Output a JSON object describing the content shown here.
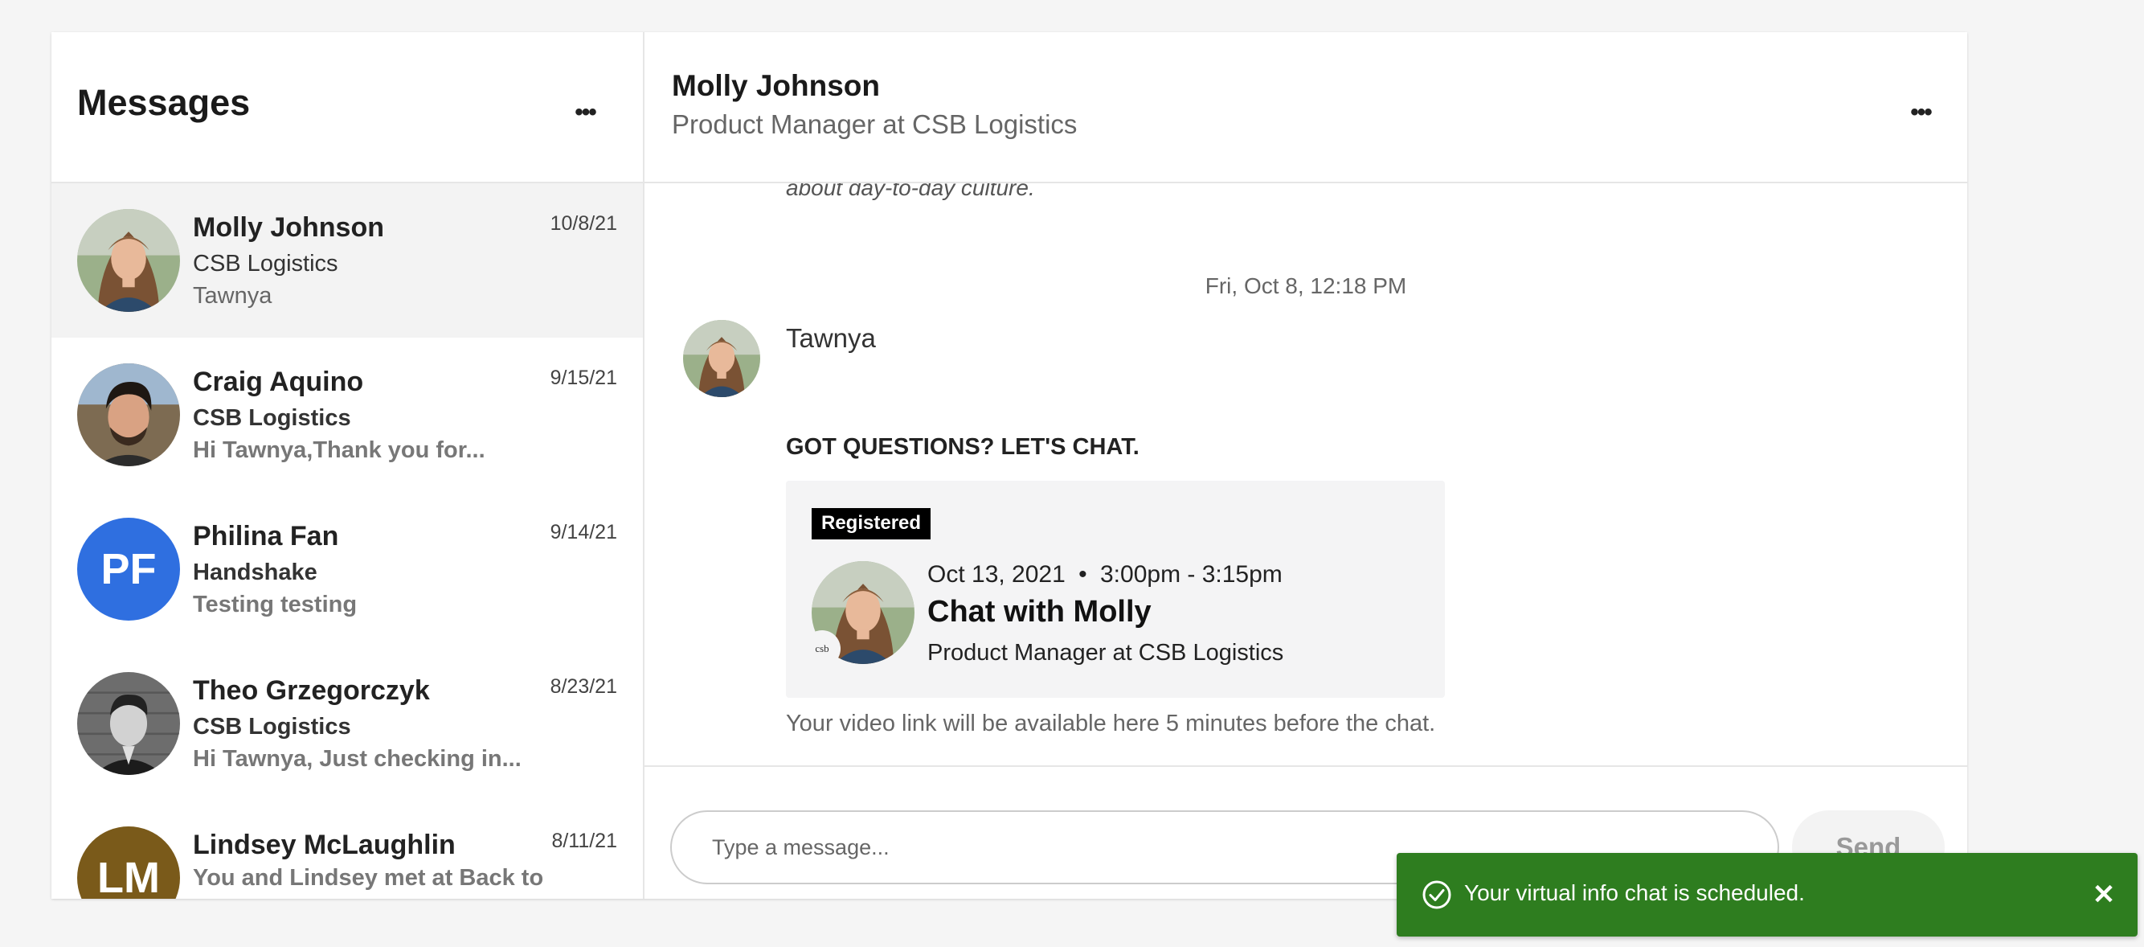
{
  "messages_panel": {
    "title": "Messages",
    "menu_icon": "ellipsis-icon",
    "conversations": [
      {
        "name": "Molly Johnson",
        "company": "CSB Logistics",
        "preview": "Tawnya",
        "date": "10/8/21",
        "avatar": "photo",
        "active": true,
        "unread": false
      },
      {
        "name": "Craig Aquino",
        "company": "CSB Logistics",
        "preview": "Hi Tawnya,Thank you for...",
        "date": "9/15/21",
        "avatar": "photo",
        "unread": true
      },
      {
        "name": "Philina Fan",
        "company": "Handshake",
        "preview": "Testing testing",
        "date": "9/14/21",
        "initials": "PF",
        "avatar_color": "#2f6fe0",
        "unread": true
      },
      {
        "name": "Theo Grzegorczyk",
        "company": "CSB Logistics",
        "preview": "Hi Tawnya, Just checking in...",
        "date": "8/23/21",
        "avatar": "photo",
        "unread": true
      },
      {
        "name": "Lindsey McLaughlin",
        "preview": "You and Lindsey met at Back to School Networking",
        "date": "8/11/21",
        "initials": "LM",
        "avatar_color": "#7a5a1a",
        "unread": true
      }
    ]
  },
  "chat": {
    "name": "Molly Johnson",
    "role": "Product Manager at CSB Logistics",
    "menu_icon": "ellipsis-icon",
    "previous_message_tail": "about day-to-day culture.",
    "timestamp": "Fri, Oct 8, 12:18 PM",
    "sender": "Tawnya",
    "event_heading": "GOT QUESTIONS? LET'S CHAT.",
    "event": {
      "badge": "Registered",
      "date": "Oct 13, 2021",
      "separator": "•",
      "time": "3:00pm - 3:15pm",
      "title": "Chat with Molly",
      "subtitle": "Product Manager at CSB Logistics",
      "logo_text": "csb"
    },
    "note": "Your video link will be available here 5 minutes before the chat."
  },
  "composer": {
    "placeholder": "Type a message...",
    "value": "",
    "send_label": "Send"
  },
  "toast": {
    "message": "Your virtual info chat is scheduled.",
    "icon": "check-circle-icon",
    "close_icon": "close-icon",
    "close_glyph": "✕",
    "color": "#2e7d1f"
  }
}
